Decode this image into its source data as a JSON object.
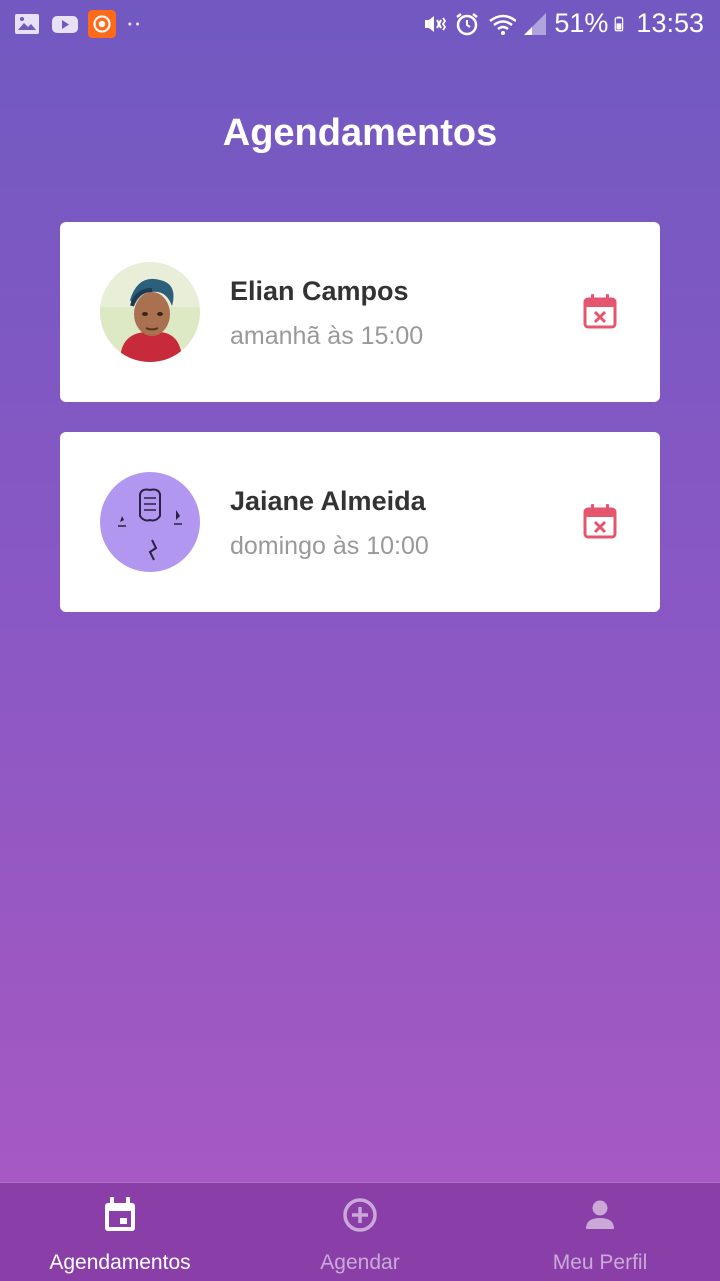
{
  "status_bar": {
    "battery": "51%",
    "time": "13:53",
    "left_icons": [
      "gallery-icon",
      "youtube-icon",
      "app-icon",
      "more-dots-icon"
    ],
    "right_icons": [
      "mute-vibrate-icon",
      "alarm-icon",
      "wifi-icon",
      "signal-icon",
      "battery-icon"
    ]
  },
  "page": {
    "title": "Agendamentos"
  },
  "appointments": [
    {
      "name": "Elian Campos",
      "time": "amanhã às 15:00",
      "avatar": "photo",
      "action_icon": "calendar-cancel-icon"
    },
    {
      "name": "Jaiane Almeida",
      "time": "domingo às 10:00",
      "avatar": "drawing",
      "action_icon": "calendar-cancel-icon"
    }
  ],
  "tabs": [
    {
      "label": "Agendamentos",
      "icon": "calendar-icon",
      "active": true
    },
    {
      "label": "Agendar",
      "icon": "add-circle-icon",
      "active": false
    },
    {
      "label": "Meu Perfil",
      "icon": "person-icon",
      "active": false
    }
  ],
  "colors": {
    "gradient_top": "#7159c1",
    "gradient_bottom": "#ab59c1",
    "cancel_icon": "#e5556e",
    "tabbar_bg": "#8a3fa8"
  }
}
